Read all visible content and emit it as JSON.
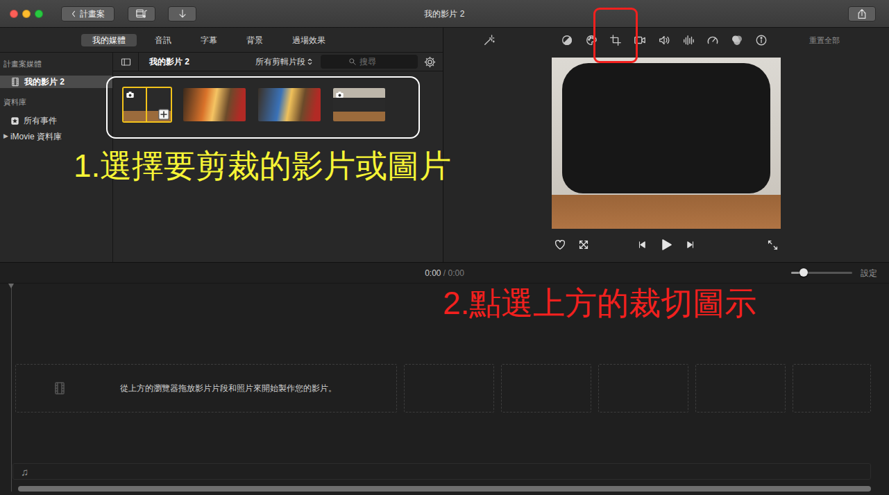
{
  "window": {
    "title": "我的影片 2",
    "back_button": "計畫案",
    "controls": [
      {
        "color": "#fd5f57"
      },
      {
        "color": "#febc2e"
      },
      {
        "color": "#28c840"
      }
    ]
  },
  "media_tabs": [
    {
      "label": "我的媒體",
      "selected": true
    },
    {
      "label": "音訊",
      "selected": false
    },
    {
      "label": "字幕",
      "selected": false
    },
    {
      "label": "背景",
      "selected": false
    },
    {
      "label": "過場效果",
      "selected": false
    }
  ],
  "sidebar": {
    "sections": [
      {
        "header": "計畫案媒體",
        "items": [
          {
            "label": "我的影片 2",
            "selected": true,
            "kind": "project"
          }
        ]
      },
      {
        "header": "資料庫",
        "items": [
          {
            "label": "所有事件",
            "selected": false,
            "kind": "events"
          },
          {
            "label": "iMovie 資料庫",
            "selected": false,
            "kind": "library",
            "expander": "▶"
          }
        ]
      }
    ]
  },
  "browser": {
    "title": "我的影片 2",
    "filter": "所有剪輯片段",
    "search": {
      "placeholder": "搜尋"
    },
    "highlighted": true,
    "clips": [
      {
        "kind": "photo",
        "selected": true
      },
      {
        "kind": "video",
        "selected": false
      },
      {
        "kind": "video",
        "selected": false
      },
      {
        "kind": "photo",
        "selected": false
      }
    ]
  },
  "inspector": {
    "tools": [
      {
        "highlighted": false
      },
      {
        "highlighted": false
      },
      {
        "highlighted": true
      },
      {
        "highlighted": false
      },
      {
        "highlighted": false
      },
      {
        "highlighted": false
      },
      {
        "highlighted": false
      },
      {
        "highlighted": false
      },
      {
        "highlighted": false
      }
    ],
    "reset": "重置全部"
  },
  "viewer": {
    "playing": false
  },
  "timeline": {
    "current": "0:00",
    "separator": "/",
    "duration": "0:00",
    "zoom": {
      "level": 0.2
    },
    "settings": "設定",
    "placeholder": "從上方的瀏覽器拖放影片片段和照片來開始製作您的影片。",
    "music_icon": "♫"
  },
  "annotations": [
    {
      "text": "1.選擇要剪裁的影片或圖片",
      "color": "#f7f536"
    },
    {
      "text": "2.點選上方的裁切圖示",
      "color": "#f2201e"
    }
  ]
}
